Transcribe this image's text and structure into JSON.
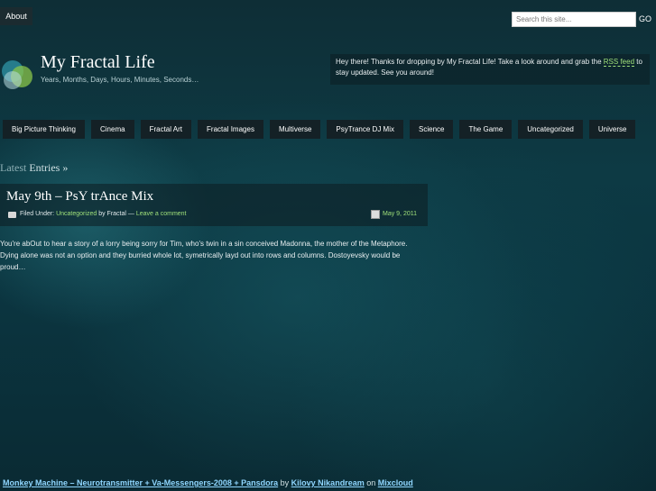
{
  "top": {
    "about_label": "About",
    "search_placeholder": "Search this site...",
    "go_label": "GO"
  },
  "header": {
    "title": "My Fractal Life",
    "tagline": "Years, Months, Days, Hours, Minutes, Seconds…",
    "welcome_before": "Hey there! Thanks for dropping by My Fractal Life! Take a look around and grab the",
    "welcome_link": "RSS feed",
    "welcome_after": "to stay updated. See you around!"
  },
  "nav": {
    "items": [
      "Big Picture Thinking",
      "Cinema",
      "Fractal Art",
      "Fractal Images",
      "Multiverse",
      "PsyTrance DJ Mix",
      "Science",
      "The Game",
      "Uncategorized",
      "Universe"
    ]
  },
  "latest": {
    "label": "Latest",
    "suffix": "Entries »"
  },
  "post": {
    "title": "May 9th – PsY trAnce Mix",
    "filed_label": "Filed Under:",
    "category": "Uncategorized",
    "by": "by",
    "author": "Fractal",
    "dash": "—",
    "comment": "Leave a comment",
    "date": "May 9, 2011",
    "excerpt": "You're abOut to hear a story of a lorry being sorry for Tim, who's twin in a sin conceived Madonna, the mother of the Metaphore. Dying alone was not an option and they burried whole lot, symetrically layd out into rows and columns. Dostoyevsky would be proud…"
  },
  "footer": {
    "track": "Monkey Machine – Neurotransmitter + Va-Messengers-2008 + Pansdora",
    "by": "by",
    "artist": "Kilovy Nikandream",
    "on": "on",
    "platform": "Mixcloud"
  },
  "colors": {
    "accent_green": "#9fe07a",
    "nav_bg": "#142126",
    "link_blue": "#8fd6ff"
  }
}
